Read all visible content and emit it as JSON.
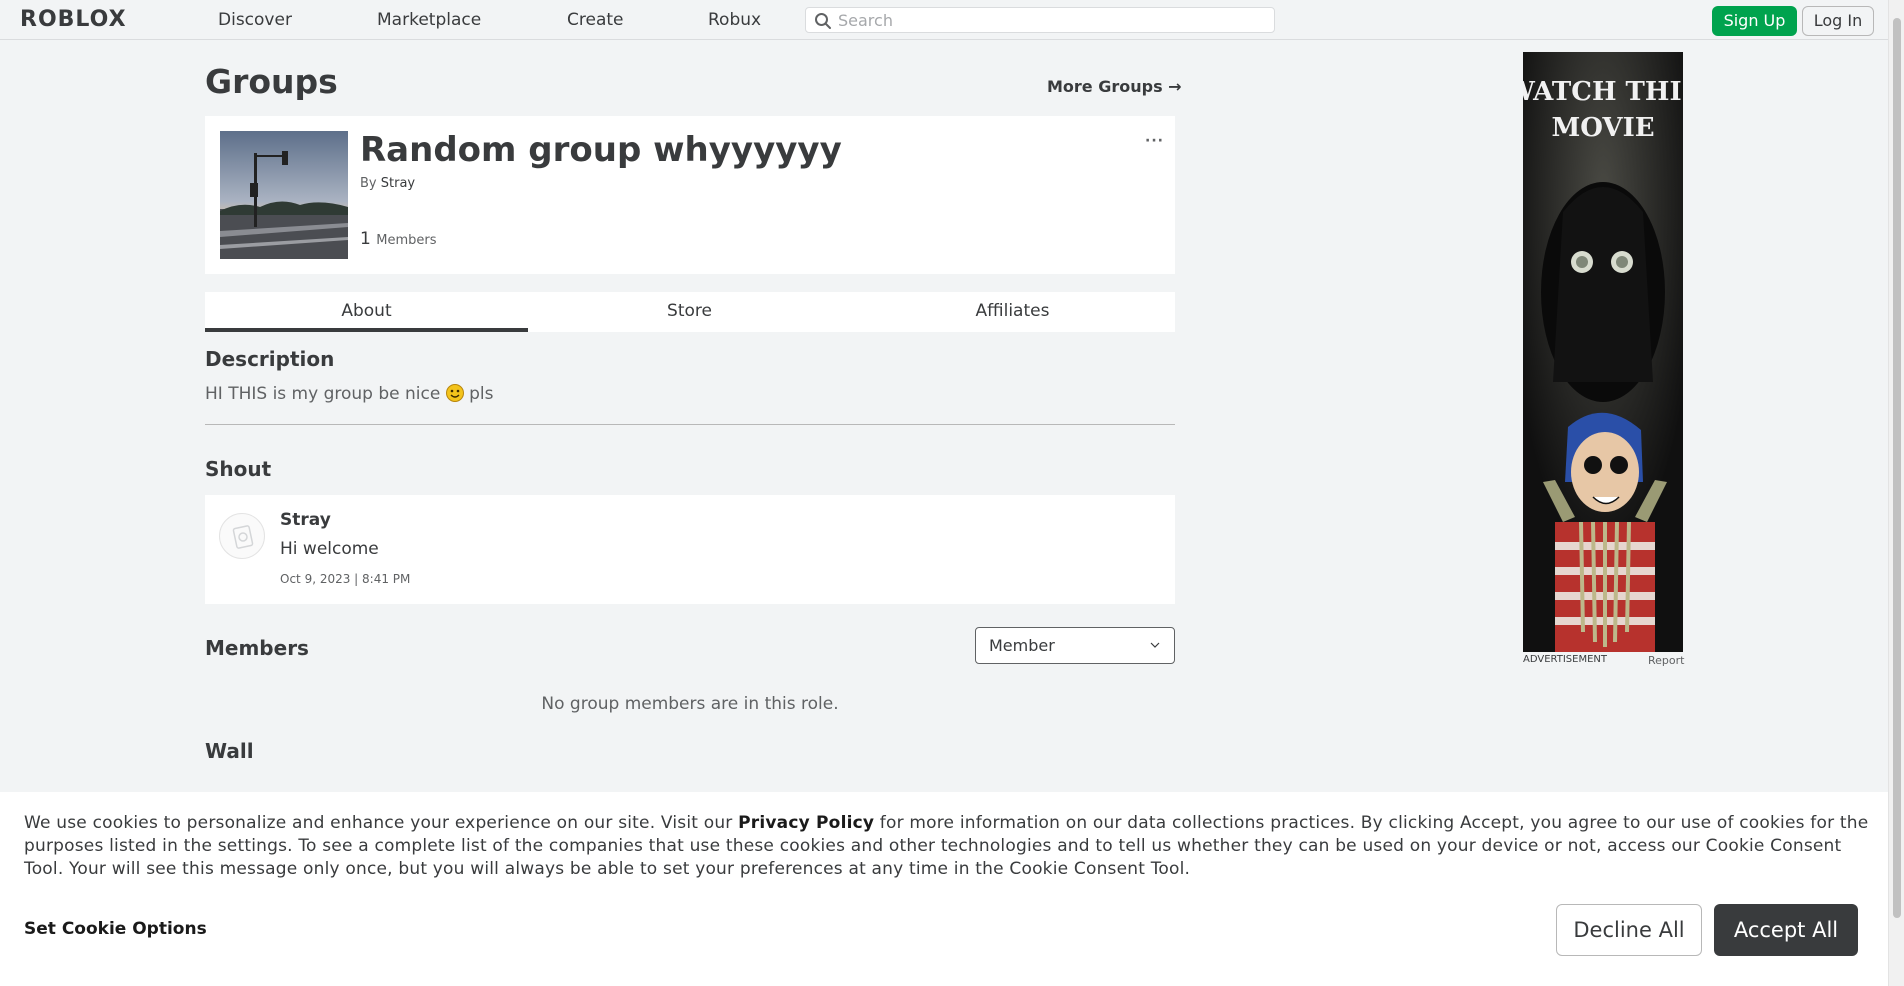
{
  "header": {
    "logo": "ROBLOX",
    "nav": [
      "Discover",
      "Marketplace",
      "Create",
      "Robux"
    ],
    "search_placeholder": "Search",
    "signup": "Sign Up",
    "login": "Log In"
  },
  "page": {
    "title": "Groups",
    "more_groups": "More Groups →"
  },
  "group": {
    "name": "Random group whyyyyyy",
    "by_prefix": "By",
    "owner": "Stray",
    "member_count": "1",
    "members_label": "Members",
    "more_menu": "···"
  },
  "tabs": [
    "About",
    "Store",
    "Affiliates"
  ],
  "description": {
    "title": "Description",
    "text_before": "HI THIS is my group be nice",
    "text_after": "pls"
  },
  "shout": {
    "title": "Shout",
    "user": "Stray",
    "text": "Hi welcome",
    "date": "Oct 9, 2023 | 8:41 PM"
  },
  "members": {
    "title": "Members",
    "role_selected": "Member",
    "empty_text": "No group members are in this role."
  },
  "wall": {
    "title": "Wall"
  },
  "ad": {
    "headline_1": "WATCH THIS",
    "headline_2": "MOVIE",
    "label": "ADVERTISEMENT",
    "report": "Report"
  },
  "cookie": {
    "text_1": "We use cookies to personalize and enhance your experience on our site. Visit our",
    "privacy": "Privacy Policy",
    "text_2": "for more information on our data collections practices. By clicking Accept, you agree to our use of cookies for the purposes listed in the settings. To see a complete list of the companies that use these cookies and other technologies and to tell us whether they can be used on your device or not, access our Cookie Consent Tool. Your will see this message only once, but you will always be able to set your preferences at any time in the Cookie Consent Tool.",
    "options": "Set Cookie Options",
    "decline": "Decline All",
    "accept": "Accept All"
  },
  "colors": {
    "accent_green": "#00a34e",
    "text_dark": "#393b3d",
    "background": "#f2f4f5"
  }
}
